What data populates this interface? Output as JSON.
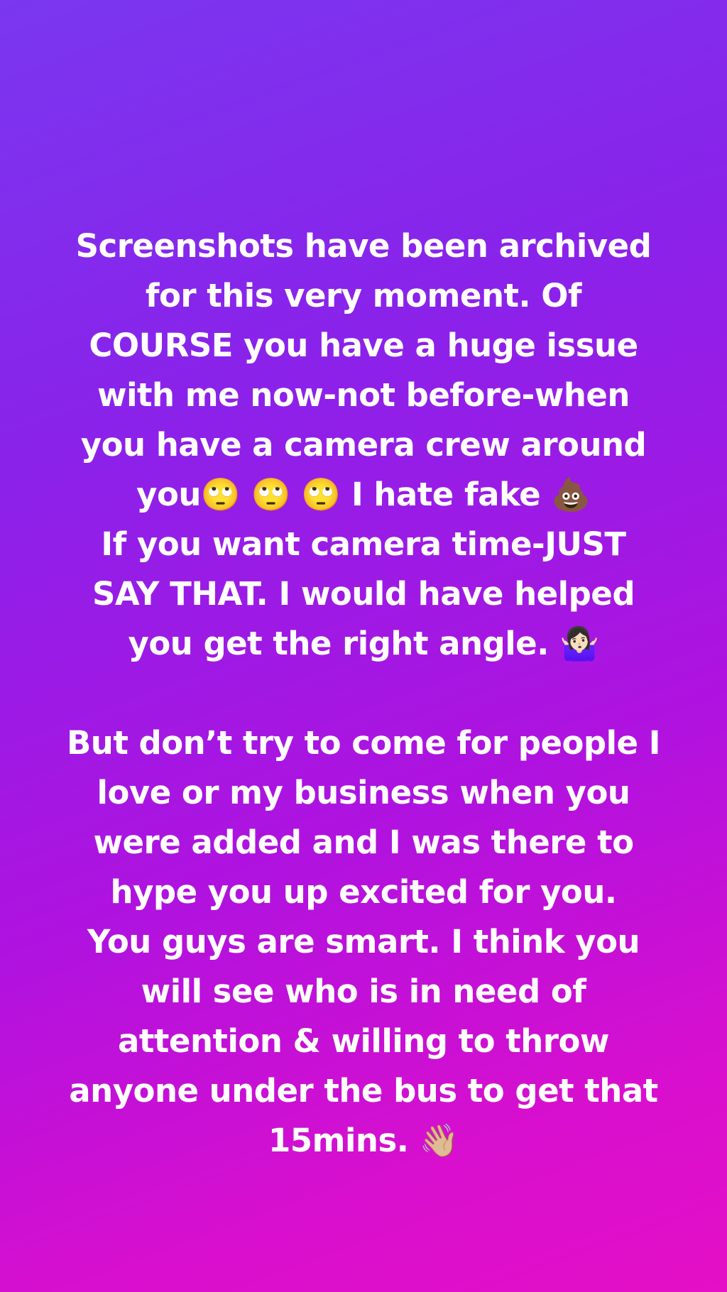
{
  "story": {
    "paragraph_1": [
      "Screenshots have been archived",
      "for this very moment. Of",
      "COURSE you have a huge issue",
      "with me now-not before-when",
      "you have a camera crew around",
      "you🙄 🙄 🙄 I hate fake 💩",
      "If you want camera time-JUST",
      "SAY THAT. I would have helped",
      "you get the right angle. 🤷🏻‍♀️"
    ],
    "paragraph_2": [
      "But don’t try to come for people I",
      "love or my business when you",
      "were added and I was there to",
      "hype you up excited for you.",
      "You guys are smart. I think you",
      "will see who is in need of",
      "attention & willing to throw",
      "anyone under the bus to get that",
      "15mins. 👋🏼"
    ]
  },
  "colors": {
    "gradient_start": "#7a37ef",
    "gradient_end": "#e40fc6",
    "text": "#ffffff"
  }
}
